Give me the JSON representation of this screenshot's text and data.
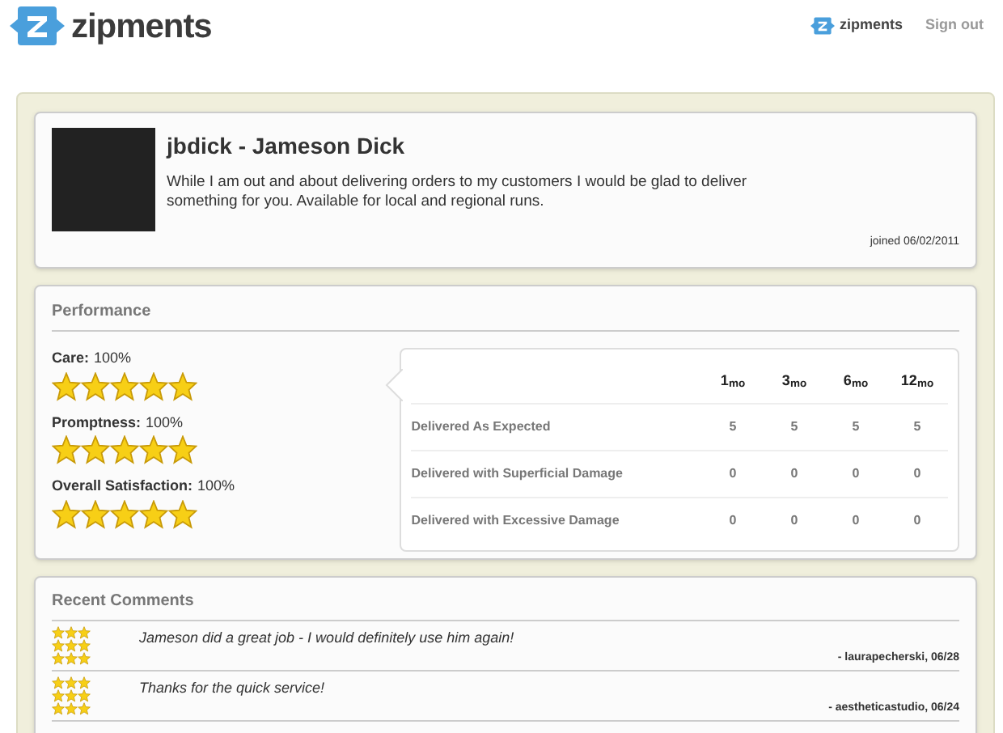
{
  "header": {
    "logo_text": "zipments",
    "nav": [
      "zipments",
      "Sign out"
    ]
  },
  "profile": {
    "title": "jbdick - Jameson Dick",
    "bio": "While I am out and about delivering orders to my customers I would be glad to deliver something for you. Available for local and regional runs.",
    "joined": "joined 06/02/2011"
  },
  "performance": {
    "title": "Performance",
    "ratings": [
      {
        "label": "Care:",
        "value": "100%",
        "stars": 5
      },
      {
        "label": "Promptness:",
        "value": "100%",
        "stars": 5
      },
      {
        "label": "Overall Satisfaction:",
        "value": "100%",
        "stars": 5
      }
    ],
    "table": {
      "columns": [
        "1$_{mo}$",
        "3$_{mo}$",
        "6$_{mo}$",
        "12$_{mo}$"
      ],
      "rows": [
        {
          "label": "Delivered As Expected",
          "values": [
            "5",
            "5",
            "5",
            "5"
          ]
        },
        {
          "label": "Delivered with Superficial Damage",
          "values": [
            "0",
            "0",
            "0",
            "0"
          ]
        },
        {
          "label": "Delivered with Excessive Damage",
          "values": [
            "0",
            "0",
            "0",
            "0"
          ]
        }
      ]
    }
  },
  "comments": {
    "title": "Recent Comments",
    "items": [
      {
        "star_rows": [
          {
            "stars": 3
          },
          {
            "stars": 3
          },
          {
            "stars": 3
          }
        ],
        "text": "Jameson did a great job - I would definitely use him again!",
        "author": "- laurapecherski, 06/28"
      },
      {
        "star_rows": [
          {
            "stars": 3
          },
          {
            "stars": 3
          },
          {
            "stars": 3
          }
        ],
        "text": "Thanks for the quick service!",
        "author": "- aestheticastudio, 06/24"
      }
    ]
  }
}
